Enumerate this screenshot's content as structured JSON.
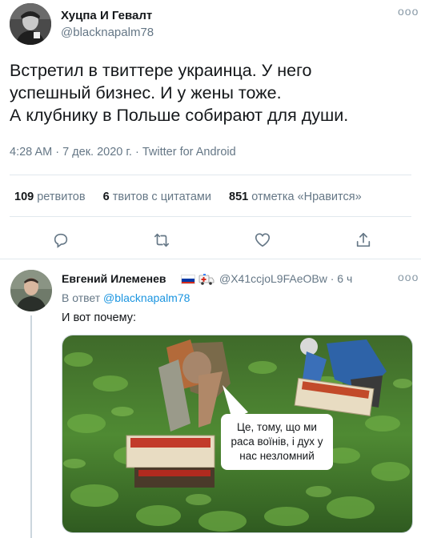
{
  "tweet": {
    "author_name": "Хуцпа И Гевалт",
    "author_handle": "@blacknapalm78",
    "more_label": "ooo",
    "text_lines": [
      "Встретил в твиттере украинца. У него",
      "успешный бизнес. И у жены тоже.",
      "А клубнику в Польше собирают для души."
    ],
    "time": "4:28 AM",
    "date": "7 дек. 2020 г.",
    "source": "Twitter for Android",
    "separator": " · ",
    "stats": {
      "retweets_count": "109",
      "retweets_label": "ретвитов",
      "quotes_count": "6",
      "quotes_label": "твитов с цитатами",
      "likes_count": "851",
      "likes_label": "отметка «Нравится»"
    }
  },
  "reply": {
    "author_name": "Евгений Илеменев",
    "author_handle": "@X41ccjoL9FAeOBw",
    "time_ago": "· 6 ч",
    "more_label": "ooo",
    "in_reply_prefix": "В ответ",
    "in_reply_handle": "@blacknapalm78",
    "text": "И вот почему:",
    "image_caption_lines": [
      "Це, тому, що ми",
      "раса воїнів, і дух у",
      "нас незломний"
    ]
  },
  "colors": {
    "text": "#14171a",
    "secondary": "#657786",
    "link": "#1b95e0",
    "border": "#e1e8ed"
  },
  "icons": [
    "reply-icon",
    "retweet-icon",
    "like-icon",
    "share-icon",
    "more-icon",
    "russia-flag-icon",
    "ambulance-icon"
  ]
}
